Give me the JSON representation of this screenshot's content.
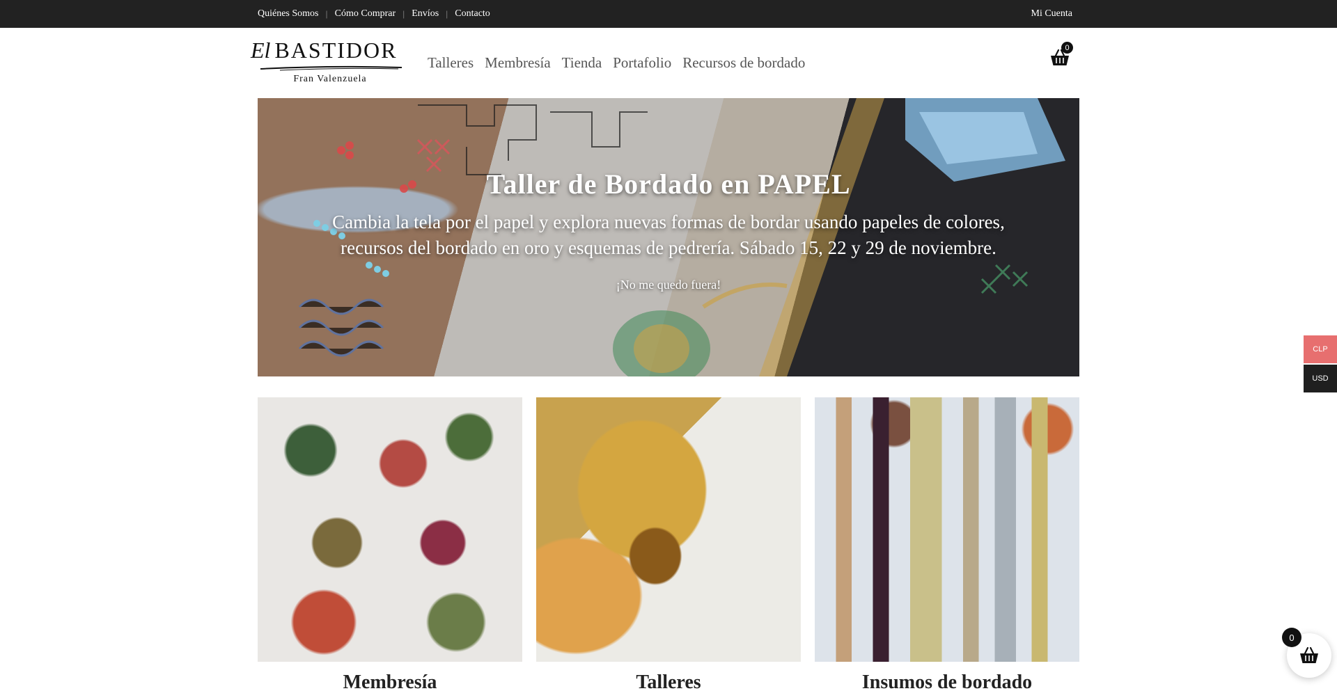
{
  "topbar": {
    "links": [
      "Quiénes Somos",
      "Cómo Comprar",
      "Envíos",
      "Contacto"
    ],
    "account": "Mi Cuenta"
  },
  "logo": {
    "prefix": "El",
    "name": "BASTIDOR",
    "subtitle": "Fran Valenzuela"
  },
  "nav": {
    "items": [
      "Talleres",
      "Membresía",
      "Tienda",
      "Portafolio",
      "Recursos de bordado"
    ]
  },
  "header_cart": {
    "count": "0",
    "icon": "basket-icon"
  },
  "hero": {
    "title": "Taller de Bordado en PAPEL",
    "description": "Cambia la tela por el papel y explora nuevas formas de bordar usando papeles de colores, recursos del bordado en oro y esquemas de pedrería. Sábado 15, 22 y 29 de noviembre.",
    "cta": "¡No me quedo fuera!"
  },
  "categories": [
    {
      "title": "Membresía"
    },
    {
      "title": "Talleres"
    },
    {
      "title": "Insumos de bordado"
    }
  ],
  "currency": {
    "options": [
      "CLP",
      "USD"
    ],
    "active": "CLP",
    "colors": {
      "active": "#e76f6f",
      "inactive": "#1f1f1f"
    }
  },
  "floating_cart": {
    "count": "0",
    "icon": "basket-icon"
  }
}
